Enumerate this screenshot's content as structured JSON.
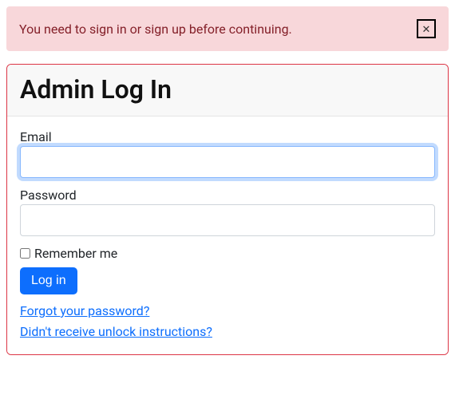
{
  "alert": {
    "message": "You need to sign in or sign up before continuing.",
    "close_symbol": "✕"
  },
  "card": {
    "title": "Admin Log In"
  },
  "form": {
    "email_label": "Email",
    "email_value": "",
    "password_label": "Password",
    "password_value": "",
    "remember_label": "Remember me",
    "remember_checked": false,
    "submit_label": "Log in"
  },
  "links": {
    "forgot_password": "Forgot your password?",
    "unlock_instructions": "Didn't receive unlock instructions?"
  }
}
